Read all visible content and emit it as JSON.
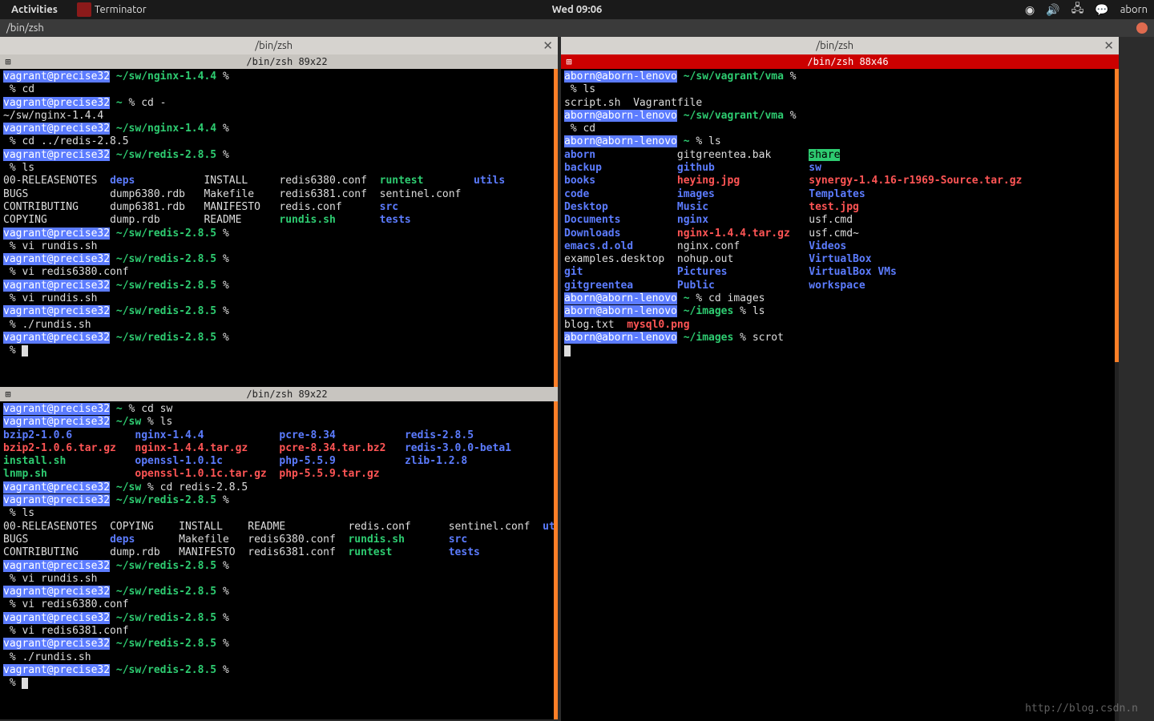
{
  "topbar": {
    "activities": "Activities",
    "app": "Terminator",
    "clock": "Wed 09:06",
    "user": "aborn"
  },
  "window_title": "/bin/zsh",
  "tabs": {
    "left": "/bin/zsh",
    "right": "/bin/zsh"
  },
  "termbars": {
    "left_top": "/bin/zsh 89x22",
    "left_bottom": "/bin/zsh 89x22",
    "right": "/bin/zsh 88x46"
  },
  "hosts": {
    "vagrant": "vagrant@precise32",
    "aborn": "aborn@aborn-lenovo"
  },
  "left_top": {
    "p": [
      {
        "path": "~/sw/nginx-1.4.4",
        "cmd": "cd"
      },
      {
        "path": "~",
        "cmd": "cd -"
      }
    ],
    "cdout": "~/sw/nginx-1.4.4",
    "p2": {
      "path": "~/sw/nginx-1.4.4",
      "cmd": "cd ../redis-2.8.5"
    },
    "p3": {
      "path": "~/sw/redis-2.8.5",
      "cmd": "ls"
    },
    "ls": {
      "h": [
        "00-RELEASENOTES",
        "deps",
        "INSTALL",
        "redis6380.conf",
        "runtest",
        "utils"
      ],
      "r1": [
        "BUGS",
        "dump6380.rdb",
        "Makefile",
        "redis6381.conf",
        "sentinel.conf",
        ""
      ],
      "r2": [
        "CONTRIBUTING",
        "dump6381.rdb",
        "MANIFESTO",
        "redis.conf",
        "src",
        ""
      ],
      "r3": [
        "COPYING",
        "dump.rdb",
        "README",
        "rundis.sh",
        "tests",
        ""
      ]
    },
    "after": [
      {
        "path": "~/sw/redis-2.8.5",
        "cmd": "vi rundis.sh"
      },
      {
        "path": "~/sw/redis-2.8.5",
        "cmd": "vi redis6380.conf"
      },
      {
        "path": "~/sw/redis-2.8.5",
        "cmd": "vi rundis.sh"
      },
      {
        "path": "~/sw/redis-2.8.5",
        "cmd": "./rundis.sh"
      },
      {
        "path": "~/sw/redis-2.8.5",
        "cmd": ""
      }
    ]
  },
  "left_bottom": {
    "p1": {
      "path": "~",
      "cmd": "cd sw"
    },
    "p2": {
      "path": "~/sw",
      "cmd": "ls"
    },
    "ls": {
      "r1": [
        "bzip2-1.0.6",
        "nginx-1.4.4",
        "pcre-8.34",
        "redis-2.8.5"
      ],
      "r2": [
        "bzip2-1.0.6.tar.gz",
        "nginx-1.4.4.tar.gz",
        "pcre-8.34.tar.bz2",
        "redis-3.0.0-beta1"
      ],
      "r3": [
        "install.sh",
        "openssl-1.0.1c",
        "php-5.5.9",
        "zlib-1.2.8"
      ],
      "r4": [
        "lnmp.sh",
        "openssl-1.0.1c.tar.gz",
        "php-5.5.9.tar.gz",
        ""
      ]
    },
    "p3": {
      "path": "~/sw",
      "cmd": "cd redis-2.8.5"
    },
    "p4": {
      "path": "~/sw/redis-2.8.5",
      "cmd": "ls"
    },
    "ls2": {
      "r1": [
        "00-RELEASENOTES",
        "COPYING",
        "INSTALL",
        "README",
        "redis.conf",
        "sentinel.conf",
        "utils"
      ],
      "r2": [
        "BUGS",
        "deps",
        "Makefile",
        "redis6380.conf",
        "rundis.sh",
        "src",
        ""
      ],
      "r3": [
        "CONTRIBUTING",
        "dump.rdb",
        "MANIFESTO",
        "redis6381.conf",
        "runtest",
        "tests",
        ""
      ]
    },
    "after": [
      {
        "path": "~/sw/redis-2.8.5",
        "cmd": "vi rundis.sh"
      },
      {
        "path": "~/sw/redis-2.8.5",
        "cmd": "vi redis6380.conf"
      },
      {
        "path": "~/sw/redis-2.8.5",
        "cmd": "vi redis6381.conf"
      },
      {
        "path": "~/sw/redis-2.8.5",
        "cmd": "./rundis.sh"
      },
      {
        "path": "~/sw/redis-2.8.5",
        "cmd": ""
      }
    ]
  },
  "right": {
    "p1": {
      "path": "~/sw/vagrant/vma",
      "cmd": "ls"
    },
    "ls1": "script.sh  Vagrantfile",
    "p2": {
      "path": "~/sw/vagrant/vma",
      "cmd": "cd"
    },
    "p3": {
      "path": "~",
      "cmd": "ls"
    },
    "cols": {
      "c1": [
        "aborn",
        "backup",
        "books",
        "code",
        "Desktop",
        "Documents",
        "Downloads",
        "emacs.d.old",
        "examples.desktop",
        "git",
        "gitgreentea"
      ],
      "c2": [
        "gitgreentea.bak",
        "github",
        "heying.jpg",
        "images",
        "Music",
        "nginx",
        "nginx-1.4.4.tar.gz",
        "nginx.conf",
        "nohup.out",
        "Pictures",
        "Public"
      ],
      "c3": [
        "share",
        "sw",
        "synergy-1.4.16-r1969-Source.tar.gz",
        "Templates",
        "test.jpg",
        "usf.cmd",
        "usf.cmd~",
        "Videos",
        "VirtualBox",
        "VirtualBox VMs",
        "workspace"
      ]
    },
    "p4": {
      "path": "~",
      "cmd": "cd images"
    },
    "p5": {
      "path": "~/images",
      "cmd": "ls"
    },
    "ls2_a": "blog.txt",
    "ls2_b": "mysql0.png",
    "p6": {
      "path": "~/images",
      "cmd": "scrot"
    }
  },
  "watermark": "http://blog.csdn.n"
}
